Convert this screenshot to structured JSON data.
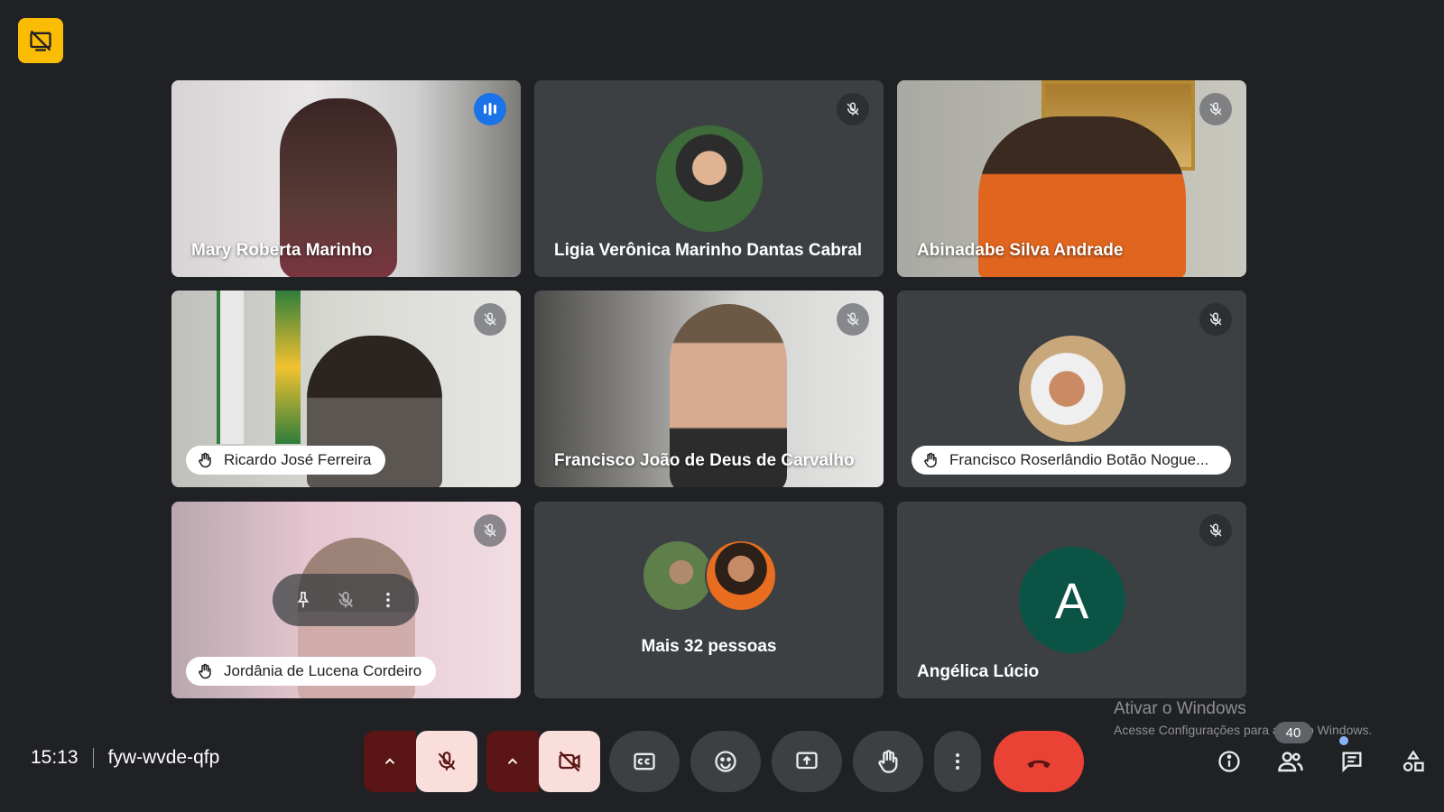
{
  "meeting": {
    "time": "15:13",
    "code": "fyw-wvde-qfp"
  },
  "tiles": [
    {
      "name": "Mary Roberta Marinho",
      "status": "speaking"
    },
    {
      "name": "Ligia Verônica Marinho Dantas Cabral",
      "status": "muted"
    },
    {
      "name": "Abinadabe Silva Andrade",
      "status": "muted"
    },
    {
      "name": "Ricardo José Ferreira",
      "status": "muted",
      "hand_raised": true
    },
    {
      "name": "Francisco João de Deus de Carvalho",
      "status": "muted"
    },
    {
      "name": "Francisco Roserlândio Botão Nogue...",
      "status": "muted",
      "hand_raised": true
    },
    {
      "name": "Jordânia de Lucena Cordeiro",
      "status": "muted",
      "hand_raised": true
    },
    {
      "name": "Mais 32 pessoas"
    },
    {
      "name": "Angélica Lúcio",
      "status": "muted",
      "avatar_letter": "A"
    }
  ],
  "watermark": {
    "line1": "Ativar o Windows",
    "line2": "Acesse Configurações para ativar o Windows."
  },
  "participants_count": "40",
  "colors": {
    "background": "#202124",
    "tile": "#3c4043",
    "accent_blue": "#1a73e8",
    "end_call_red": "#ea4335",
    "badge_yellow": "#fbbc04",
    "avatar_green": "#0b5345"
  },
  "icons": {
    "corner": "presentation-off-icon",
    "controls": [
      "chevron-up-icon",
      "mic-off-icon",
      "chevron-up-icon",
      "camera-off-icon",
      "captions-icon",
      "emoji-icon",
      "present-screen-icon",
      "raise-hand-icon",
      "more-options-icon",
      "end-call-icon"
    ],
    "right": [
      "info-icon",
      "people-icon",
      "chat-icon",
      "activities-icon"
    ]
  }
}
